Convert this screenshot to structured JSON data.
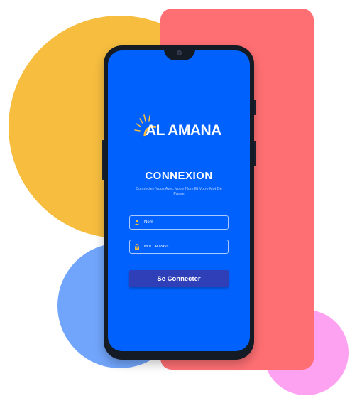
{
  "brand": {
    "logo_text": "AL AMANA"
  },
  "login": {
    "title": "CONNEXION",
    "subtitle": "Connectez-Vous Avec Votre Nom Et Votre Mot De Passe",
    "username_placeholder": "Nom",
    "password_placeholder": "Mot De Pass",
    "submit_label": "Se Connecter",
    "username_icon": "user-icon",
    "password_icon": "lock-icon"
  },
  "colors": {
    "screen_bg": "#0161fd",
    "button_bg": "#2e3fb8",
    "icon_accent": "#f6bd3f",
    "yellow_circle": "#f6bd3f",
    "blue_circle": "#71a5fb",
    "pink_circle": "#fda1f1",
    "red_panel": "#fe6f73",
    "phone_frame": "#151b24"
  }
}
